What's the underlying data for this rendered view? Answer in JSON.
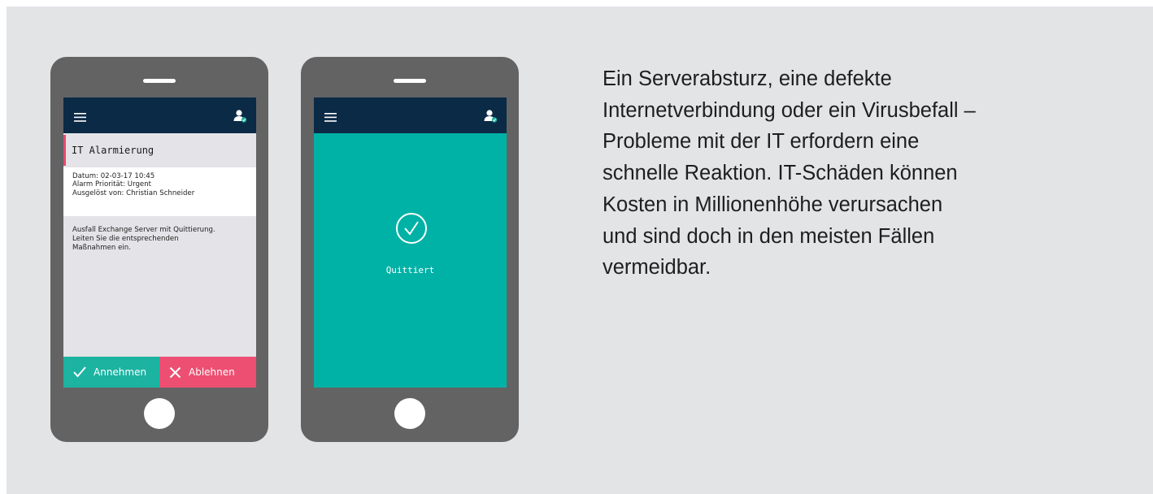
{
  "phone_left": {
    "menu_icon": "hamburger-menu-icon",
    "user_icon": "user-check-icon",
    "alarm_title": "IT Alarmierung",
    "meta": [
      "Datum: 02-03-17 10:45",
      "Alarm Priorität: Urgent",
      "Ausgelöst von: Christian Schneider"
    ],
    "message": [
      "Ausfall Exchange Server mit Quittierung.",
      "Leiten Sie die entsprechenden",
      "Maßnahmen ein."
    ],
    "accept_label": "Annehmen",
    "reject_label": "Ablehnen",
    "colors": {
      "topbar": "#0a2a46",
      "accent_bar": "#e94a6b",
      "accept": "#1cb3a1",
      "reject": "#ec4f72"
    }
  },
  "phone_right": {
    "menu_icon": "hamburger-menu-icon",
    "user_icon": "user-check-icon",
    "status_icon": "check-circle-icon",
    "status_label": "Quittiert",
    "colors": {
      "screen": "#00b1a5"
    }
  },
  "description": [
    "Ein Serverabsturz, eine defekte",
    "Internetverbindung oder ein Virusbefall –",
    "Probleme mit der IT erfordern eine",
    "schnelle Reaktion. IT-Schäden können",
    "Kosten in Millionenhöhe verursachen",
    "und sind doch in den meisten Fällen",
    "vermeidbar."
  ]
}
